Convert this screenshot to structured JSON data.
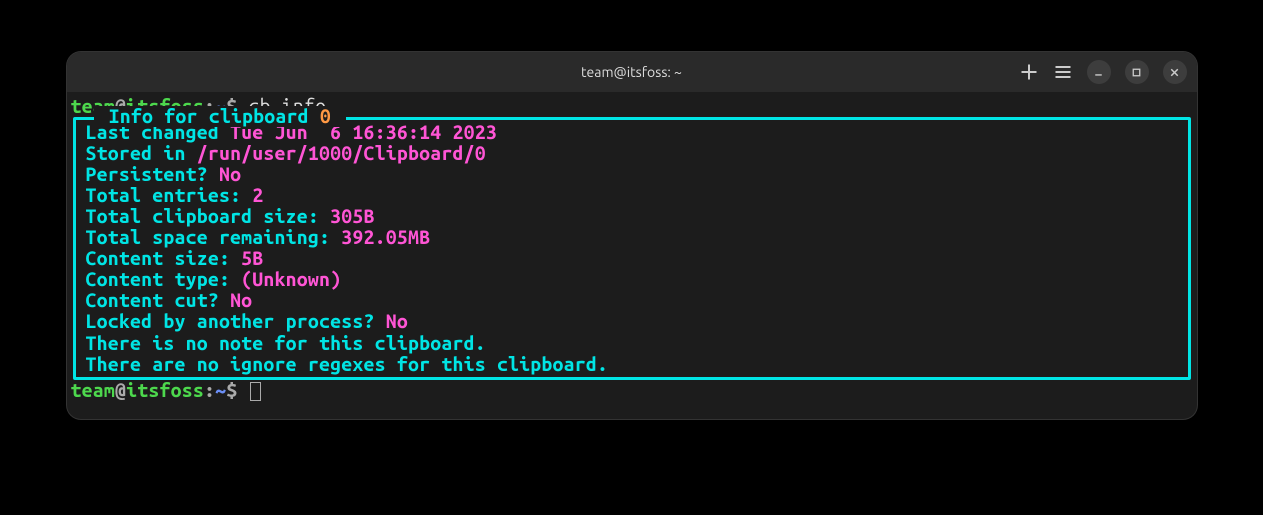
{
  "titlebar": {
    "title": "team@itsfoss: ~"
  },
  "prompt1": {
    "user": "team",
    "at": "@",
    "host": "itsfoss",
    "colon": ":",
    "path": "~",
    "dollar": "$ ",
    "command": "cb info"
  },
  "info": {
    "header_prefix": " Info for clipboard ",
    "header_num": "0",
    "header_suffix": " ",
    "lines": {
      "last_changed_label": "Last changed ",
      "last_changed_value": "Tue Jun  6 16:36:14 2023",
      "stored_in_label": "Stored in ",
      "stored_in_value": "/run/user/1000/Clipboard/0",
      "persistent_label": "Persistent? ",
      "persistent_value": "No",
      "total_entries_label": "Total entries: ",
      "total_entries_value": "2",
      "clip_size_label": "Total clipboard size: ",
      "clip_size_value": "305B",
      "space_remaining_label": "Total space remaining: ",
      "space_remaining_value": "392.05MB",
      "content_size_label": "Content size: ",
      "content_size_value": "5B",
      "content_type_label": "Content type: ",
      "content_type_value": "(Unknown)",
      "content_cut_label": "Content cut? ",
      "content_cut_value": "No",
      "locked_label": "Locked by another process? ",
      "locked_value": "No",
      "no_note": "There is no note for this clipboard.",
      "no_ignore": "There are no ignore regexes for this clipboard."
    }
  },
  "prompt2": {
    "user": "team",
    "at": "@",
    "host": "itsfoss",
    "colon": ":",
    "path": "~",
    "dollar": "$ "
  }
}
